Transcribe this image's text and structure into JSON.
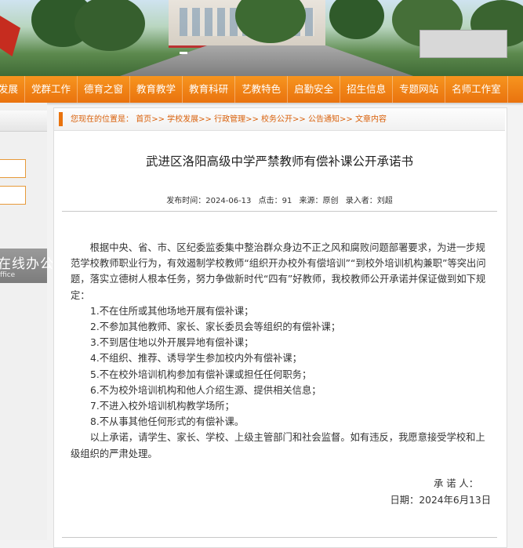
{
  "nav": {
    "items": [
      "发展",
      "党群工作",
      "德育之窗",
      "教育教学",
      "教育科研",
      "艺教特色",
      "启勤安全",
      "招生信息",
      "专题网站",
      "名师工作室"
    ]
  },
  "sidebar": {
    "office_label": "在线办公",
    "office_sub": "ffice"
  },
  "breadcrumb": {
    "prefix": "您现在的位置是：",
    "items": [
      "首页",
      "学校发展",
      "行政管理",
      "校务公开",
      "公告通知",
      "文章内容"
    ],
    "sep": ">>"
  },
  "article": {
    "title": "武进区洛阳高级中学严禁教师有偿补课公开承诺书",
    "meta": {
      "time": "发布时间：2024-06-13",
      "clicks": "点击：91",
      "source": "来源：原创",
      "editor": "录入者：刘超"
    },
    "intro": "根据中央、省、市、区纪委监委集中整治群众身边不正之风和腐败问题部署要求，为进一步规范学校教师职业行为，有效遏制学校教师“组织开办校外有偿培训”“到校外培训机构兼职”等突出问题，落实立德树人根本任务，努力争做新时代“四有”好教师，我校教师公开承诺并保证做到如下规定：",
    "items": [
      "1.不在住所或其他场地开展有偿补课；",
      "2.不参加其他教师、家长、家长委员会等组织的有偿补课；",
      "3.不到居住地以外开展异地有偿补课；",
      "4.不组织、推荐、诱导学生参加校内外有偿补课；",
      "5.不在校外培训机构参加有偿补课或担任任何职务；",
      "6.不为校外培训机构和他人介绍生源、提供相关信息；",
      "7.不进入校外培训机构教学场所；",
      "8.不从事其他任何形式的有偿补课。"
    ],
    "closing": "以上承诺，请学生、家长、学校、上级主管部门和社会监督。如有违反，我愿意接受学校和上级组织的严肃处理。",
    "signer": "承 诺 人：",
    "date": "日期：2024年6月13日"
  }
}
